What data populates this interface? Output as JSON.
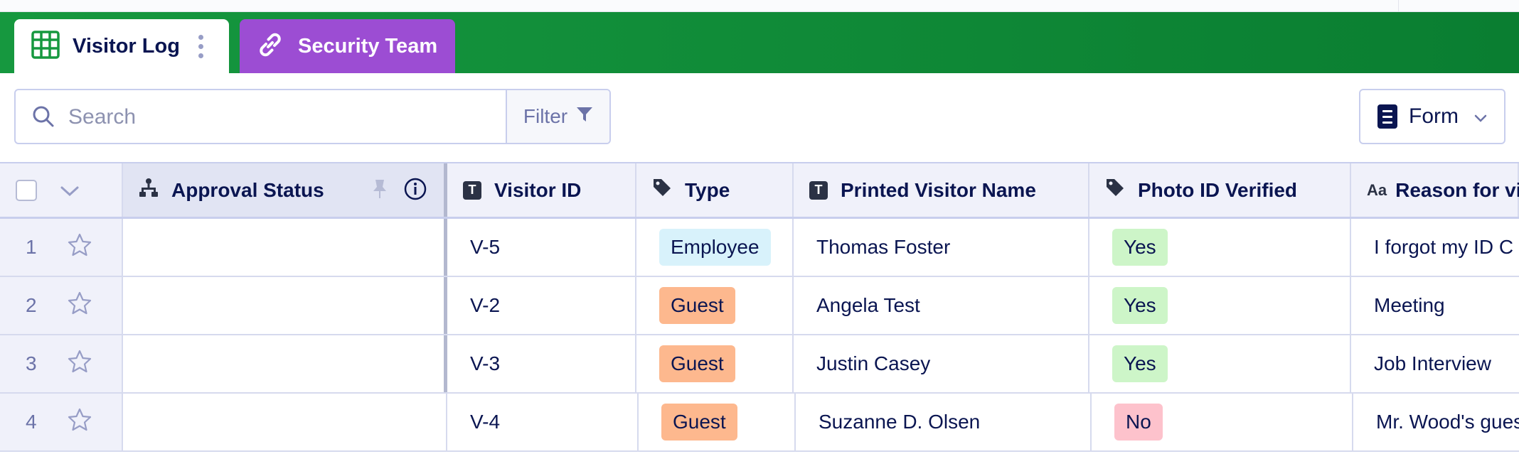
{
  "tabs": [
    {
      "label": "Visitor Log",
      "icon": "grid-table-icon",
      "color": "#ffffff",
      "active": true
    },
    {
      "label": "Security Team",
      "icon": "link-icon",
      "color": "#9c4dd3",
      "active": false
    }
  ],
  "colors": {
    "header_bar": "#0a7e31",
    "brand_text": "#0a1551",
    "security_tab": "#9c4dd3"
  },
  "toolbar": {
    "search_placeholder": "Search",
    "filter_label": "Filter",
    "form_label": "Form"
  },
  "table": {
    "columns": [
      {
        "label": "Approval Status",
        "icon": "org-chart-icon"
      },
      {
        "label": "Visitor ID",
        "icon": "text-field-icon"
      },
      {
        "label": "Type",
        "icon": "tag-icon"
      },
      {
        "label": "Printed Visitor Name",
        "icon": "text-field-icon"
      },
      {
        "label": "Photo ID Verified",
        "icon": "tag-icon"
      },
      {
        "label": "Reason for vi",
        "icon": "long-text-icon"
      }
    ],
    "rows": [
      {
        "num": "1",
        "approval": "",
        "visitor_id": "V-5",
        "type": "Employee",
        "name": "Thomas Foster",
        "photo_verified": "Yes",
        "reason": "I forgot my ID C"
      },
      {
        "num": "2",
        "approval": "",
        "visitor_id": "V-2",
        "type": "Guest",
        "name": "Angela Test",
        "photo_verified": "Yes",
        "reason": "Meeting"
      },
      {
        "num": "3",
        "approval": "",
        "visitor_id": "V-3",
        "type": "Guest",
        "name": "Justin Casey",
        "photo_verified": "Yes",
        "reason": "Job Interview"
      },
      {
        "num": "4",
        "approval": "",
        "visitor_id": "V-4",
        "type": "Guest",
        "name": "Suzanne D. Olsen",
        "photo_verified": "No",
        "reason": "Mr. Wood's gues"
      }
    ]
  }
}
